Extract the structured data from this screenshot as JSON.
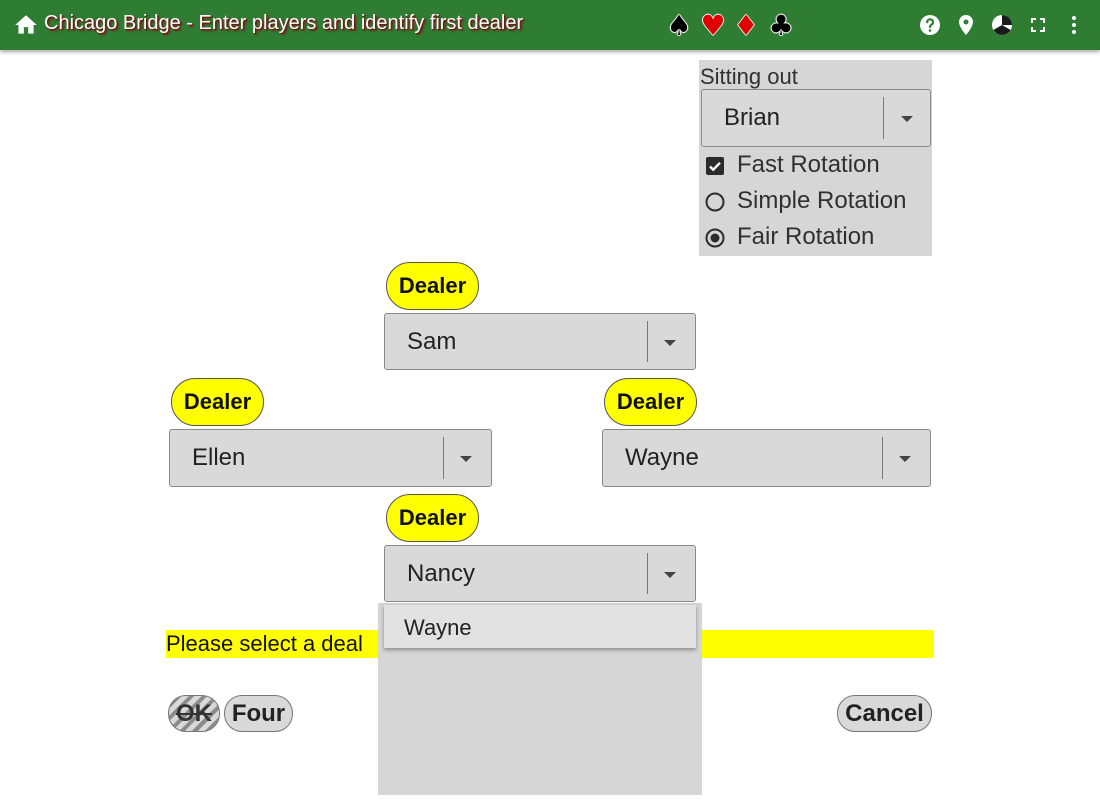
{
  "header": {
    "title": "Chicago Bridge - Enter players and identify first dealer",
    "suits": [
      {
        "icon": "spade-icon",
        "glyph": "♠",
        "color": "#000000"
      },
      {
        "icon": "heart-icon",
        "glyph": "♥",
        "color": "#e00000"
      },
      {
        "icon": "diamond-icon",
        "glyph": "♦",
        "color": "#e00000"
      },
      {
        "icon": "club-icon",
        "glyph": "♣",
        "color": "#000000"
      }
    ],
    "actions": [
      "home-icon",
      "help-icon",
      "location-icon",
      "theme-icon",
      "fullscreen-icon",
      "more-icon"
    ],
    "bar_color": "#2e7d32"
  },
  "sitting_out": {
    "label": "Sitting out",
    "selected": "Brian",
    "options": [
      {
        "label": "Fast Rotation",
        "type": "checkbox",
        "checked": true
      },
      {
        "label": "Simple Rotation",
        "type": "radio",
        "checked": false
      },
      {
        "label": "Fair Rotation",
        "type": "radio",
        "checked": true
      }
    ]
  },
  "seats": {
    "north": {
      "dealer_label": "Dealer",
      "player": "Sam"
    },
    "west": {
      "dealer_label": "Dealer",
      "player": "Ellen"
    },
    "east": {
      "dealer_label": "Dealer",
      "player": "Wayne"
    },
    "south": {
      "dealer_label": "Dealer",
      "player": "Nancy"
    }
  },
  "dropdown": {
    "items": [
      "Wayne"
    ]
  },
  "status": {
    "text": "Please select a deal",
    "color": "#ffff00"
  },
  "buttons": {
    "ok": "OK",
    "four": "Four",
    "cancel": "Cancel"
  }
}
